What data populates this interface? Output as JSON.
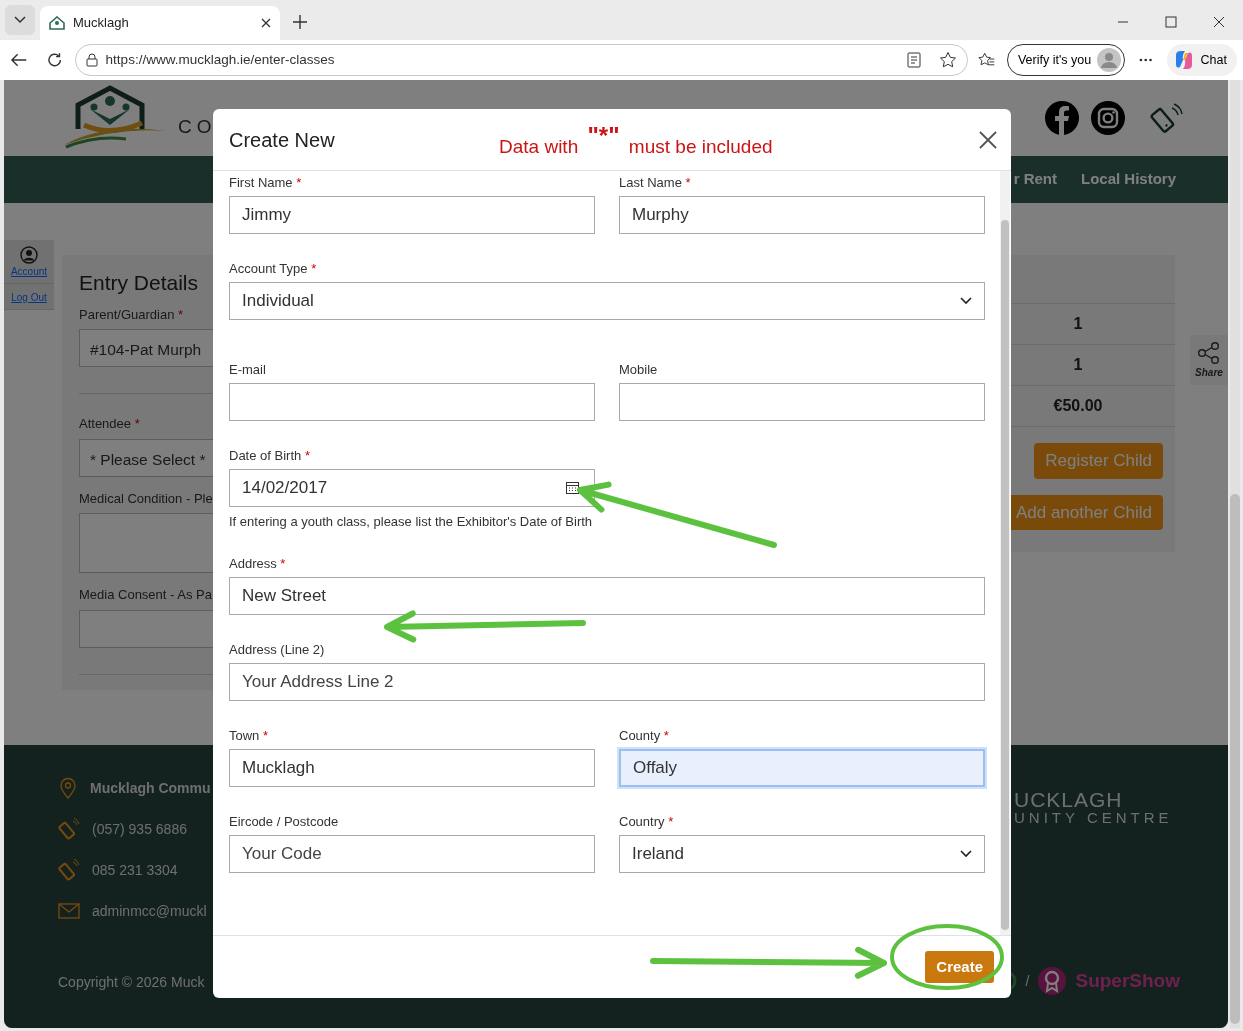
{
  "browser": {
    "tabs": [
      {
        "title": "Mucklagh",
        "selected": true
      }
    ],
    "address": "https://www.mucklagh.ie/enter-classes",
    "verify_button": "Verify it's you",
    "chat_button": "Chat"
  },
  "site": {
    "logo_text": "CO",
    "nav": [
      "r Rent",
      "Local History"
    ],
    "side_menu": [
      {
        "label": "Account",
        "kind": "account"
      },
      {
        "label": "Log Out",
        "kind": "link"
      }
    ],
    "entry_details": {
      "title": "Entry Details",
      "fields": [
        {
          "label": "Parent/Guardian",
          "required_mark": "*",
          "kind": "input",
          "value": "#104-Pat Murph",
          "divider_after": true
        },
        {
          "label": "Attendee",
          "required_mark": "*",
          "kind": "input",
          "value": "* Please Select *",
          "divider_after": false
        },
        {
          "label": "Medical Condition - Ple",
          "kind": "textarea",
          "divider_after": false
        },
        {
          "label": "Media Consent - As Pa",
          "kind": "input",
          "divider_after": true
        }
      ]
    },
    "summary": {
      "rows": [
        "1",
        "1",
        "€50.00"
      ],
      "buttons": [
        "Register Child",
        "Add another Child"
      ]
    },
    "share": "Share",
    "footer": {
      "contacts": [
        {
          "kind": "location",
          "text": "Mucklagh Commu"
        },
        {
          "kind": "phone",
          "text": "(057) 935 6886"
        },
        {
          "kind": "phone",
          "text": "085 231 3304"
        },
        {
          "kind": "email",
          "text": "adminmcc@muckl"
        }
      ],
      "brand": [
        "UCKLAGH",
        "UNITY CENTRE"
      ],
      "copyright": "Copyright © 2026 Muck",
      "credit_separator": "/",
      "credit": "SuperShow"
    }
  },
  "modal": {
    "title": "Create New",
    "notice_before": "Data with",
    "notice_mark": "\"*\"",
    "notice_after": "must be included",
    "fields": [
      {
        "label": "First Name",
        "required_mark": "*",
        "kind": "text",
        "value": "Jimmy",
        "wide": false,
        "focused": false
      },
      {
        "label": "Last Name",
        "required_mark": "*",
        "kind": "text",
        "value": "Murphy",
        "wide": false,
        "focused": false
      },
      {
        "label": "Account Type",
        "required_mark": "*",
        "kind": "select",
        "value": "Individual",
        "wide": true,
        "focused": false
      },
      {
        "label": "E-mail",
        "kind": "text",
        "wide": false,
        "focused": false
      },
      {
        "label": "Mobile",
        "kind": "text",
        "wide": false,
        "focused": false
      },
      {
        "label": "Date of Birth",
        "required_mark": "*",
        "kind": "date",
        "value": "14/02/2017",
        "hint": "If entering a youth class, please list the Exhibitor's Date of Birth",
        "wide": false,
        "focused": false
      },
      {
        "label": "Address",
        "required_mark": "*",
        "kind": "text",
        "value": "New Street",
        "wide": true,
        "focused": false
      },
      {
        "label": "Address (Line 2)",
        "kind": "text",
        "placeholder": "Your Address Line 2",
        "wide": true,
        "focused": false
      },
      {
        "label": "Town",
        "required_mark": "*",
        "kind": "text",
        "value": "Mucklagh",
        "wide": false,
        "focused": false
      },
      {
        "label": "County",
        "required_mark": "*",
        "kind": "text",
        "value": "Offaly",
        "wide": false,
        "focused": true
      },
      {
        "label": "Eircode / Postcode",
        "kind": "text",
        "placeholder": "Your Code",
        "wide": false,
        "focused": false
      },
      {
        "label": "Country",
        "required_mark": "*",
        "kind": "select",
        "value": "Ireland",
        "wide": false,
        "focused": false
      }
    ],
    "create_button": "Create"
  }
}
